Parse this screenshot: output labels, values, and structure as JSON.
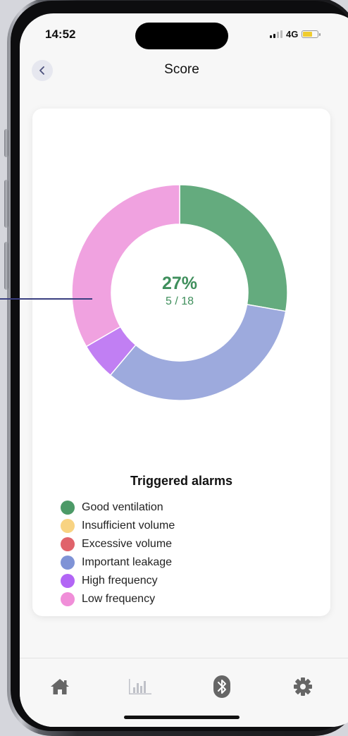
{
  "status_bar": {
    "time": "14:52",
    "network": "4G"
  },
  "header": {
    "title": "Score"
  },
  "chart_data": {
    "type": "pie",
    "categories": [
      "Good ventilation",
      "Insufficient volume",
      "Excessive volume",
      "Important leakage",
      "High frequency",
      "Low frequency"
    ],
    "values": [
      5,
      0,
      0,
      6,
      1,
      6
    ],
    "colors": [
      "#64ab7e",
      "#f7d17f",
      "#e0636b",
      "#9daadd",
      "#c17ff3",
      "#f0a2e0"
    ],
    "center_percent": "27%",
    "center_fraction": "5 / 18"
  },
  "legend": {
    "title": "Triggered alarms",
    "items": [
      {
        "label": "Good ventilation",
        "color": "#4c9a67"
      },
      {
        "label": "Insufficient volume",
        "color": "#f8d382"
      },
      {
        "label": "Excessive volume",
        "color": "#e0636b"
      },
      {
        "label": "Important leakage",
        "color": "#7f93d6"
      },
      {
        "label": "High frequency",
        "color": "#b265f5"
      },
      {
        "label": "Low frequency",
        "color": "#f08ed8"
      }
    ]
  },
  "tab_bar": {
    "tabs": [
      {
        "icon": "home-icon",
        "active": false
      },
      {
        "icon": "chart-icon",
        "active": true
      },
      {
        "icon": "bluetooth-icon",
        "active": false
      },
      {
        "icon": "gear-icon",
        "active": false
      }
    ]
  }
}
